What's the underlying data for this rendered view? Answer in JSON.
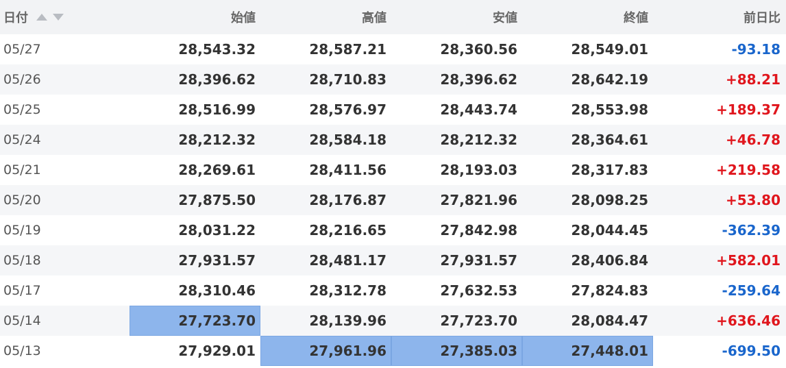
{
  "table": {
    "headers": {
      "date": "日付",
      "open": "始値",
      "high": "高値",
      "low": "安値",
      "close": "終値",
      "change": "前日比"
    },
    "rows": [
      {
        "date": "05/27",
        "open": "28,543.32",
        "high": "28,587.21",
        "low": "28,360.56",
        "close": "28,549.01",
        "change": "-93.18"
      },
      {
        "date": "05/26",
        "open": "28,396.62",
        "high": "28,710.83",
        "low": "28,396.62",
        "close": "28,642.19",
        "change": "+88.21"
      },
      {
        "date": "05/25",
        "open": "28,516.99",
        "high": "28,576.97",
        "low": "28,443.74",
        "close": "28,553.98",
        "change": "+189.37"
      },
      {
        "date": "05/24",
        "open": "28,212.32",
        "high": "28,584.18",
        "low": "28,212.32",
        "close": "28,364.61",
        "change": "+46.78"
      },
      {
        "date": "05/21",
        "open": "28,269.61",
        "high": "28,411.56",
        "low": "28,193.03",
        "close": "28,317.83",
        "change": "+219.58"
      },
      {
        "date": "05/20",
        "open": "27,875.50",
        "high": "28,176.87",
        "low": "27,821.96",
        "close": "28,098.25",
        "change": "+53.80"
      },
      {
        "date": "05/19",
        "open": "28,031.22",
        "high": "28,216.65",
        "low": "27,842.98",
        "close": "28,044.45",
        "change": "-362.39"
      },
      {
        "date": "05/18",
        "open": "27,931.57",
        "high": "28,481.17",
        "low": "27,931.57",
        "close": "28,406.84",
        "change": "+582.01"
      },
      {
        "date": "05/17",
        "open": "28,310.46",
        "high": "28,312.78",
        "low": "27,632.53",
        "close": "27,824.83",
        "change": "-259.64"
      },
      {
        "date": "05/14",
        "open": "27,723.70",
        "high": "28,139.96",
        "low": "27,723.70",
        "close": "28,084.47",
        "change": "+636.46"
      },
      {
        "date": "05/13",
        "open": "27,929.01",
        "high": "27,961.96",
        "low": "27,385.03",
        "close": "27,448.01",
        "change": "-699.50"
      }
    ]
  },
  "colors": {
    "positive": "#e0161d",
    "negative": "#1a66cc",
    "highlight": "#8db5ec"
  },
  "icons": {
    "sort_asc": "triangle-up-icon",
    "sort_desc": "triangle-down-icon"
  }
}
